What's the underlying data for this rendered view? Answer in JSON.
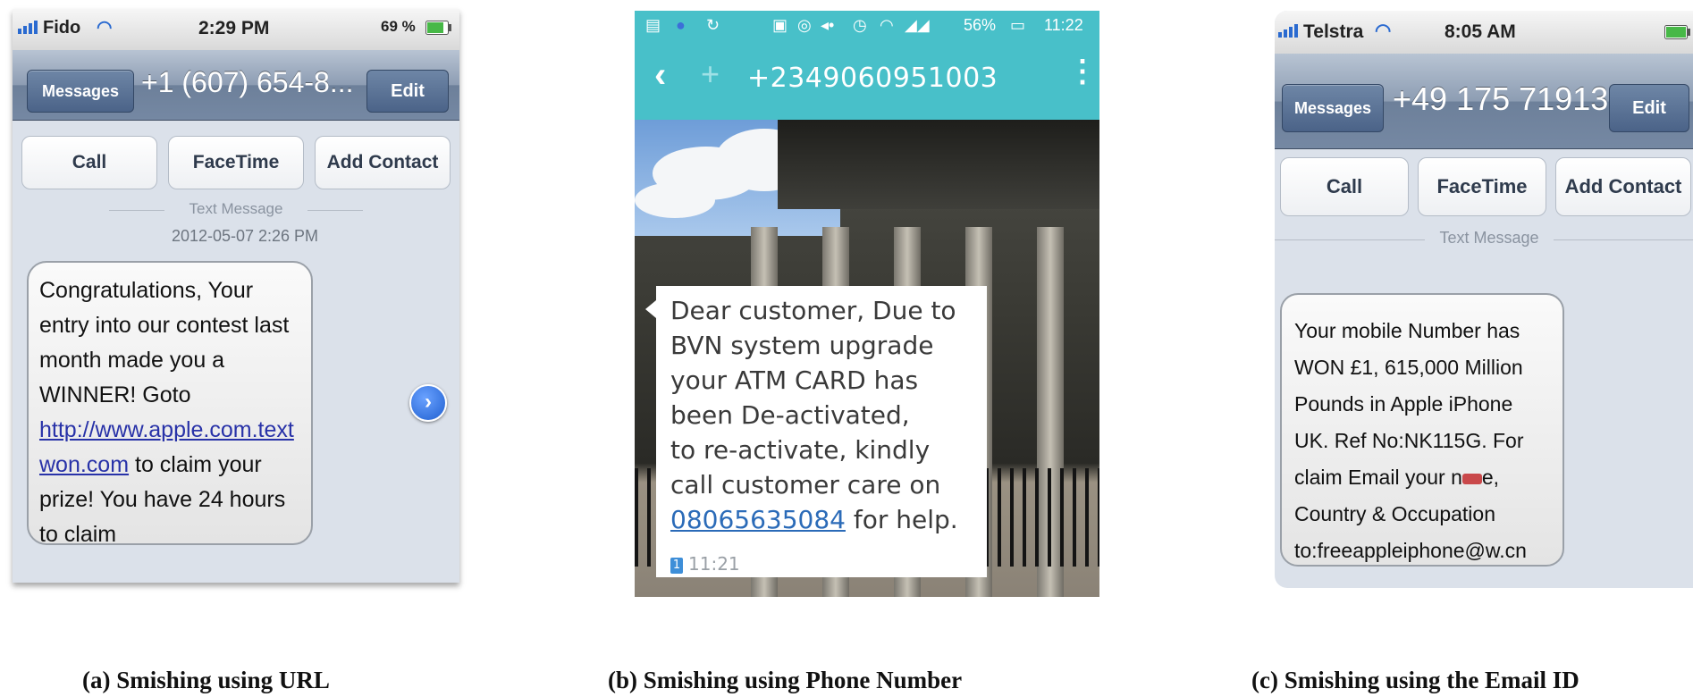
{
  "panel_a": {
    "status": {
      "carrier": "Fido",
      "time": "2:29 PM",
      "battery": "69 %"
    },
    "nav": {
      "back_label": "Messages",
      "title": "+1 (607) 654-8...",
      "edit_label": "Edit"
    },
    "actions": [
      "Call",
      "FaceTime",
      "Add Contact"
    ],
    "separator_label": "Text Message",
    "timestamp": "2012-05-07 2:26 PM",
    "message_lines": [
      "Congratulations, Your",
      "entry into our contest last",
      "month made you a",
      "WINNER! Goto"
    ],
    "link_line_1": "http://www.apple.com.text",
    "link_line_2": "won.com",
    "link_line_2_tail": " to claim your",
    "message_tail_lines": [
      "prize! You have 24 hours",
      "to claim"
    ],
    "detail_icon": "chevron-right-icon",
    "caption": "(a) Smishing using URL"
  },
  "panel_b": {
    "status": {
      "battery": "56%",
      "time": "11:22"
    },
    "title": "+2349060951003",
    "message_lines": [
      "Dear customer, Due to",
      "BVN system upgrade",
      "your ATM CARD has",
      "been De-activated,",
      "to re-activate, kindly",
      "call customer care on"
    ],
    "phone_number": "08065635084",
    "phone_tail": " for help.",
    "sim_label": "1",
    "message_time": "11:21",
    "caption": "(b) Smishing using Phone Number"
  },
  "panel_c": {
    "status": {
      "carrier": "Telstra",
      "time": "8:05 AM"
    },
    "nav": {
      "back_label": "Messages",
      "title": "+49 175 71913...",
      "edit_label": "Edit"
    },
    "actions": [
      "Call",
      "FaceTime",
      "Add Contact"
    ],
    "separator_label": "Text Message",
    "message_lines": [
      "Your mobile Number has",
      "WON £1, 615,000 Million",
      "Pounds in Apple iPhone",
      "UK. Ref No:NK115G. For"
    ],
    "line5_start": "claim Email your n",
    "line5_end": "e,",
    "message_tail_lines": [
      "Country & Occupation",
      "to:freeappleiphone@w.cn"
    ],
    "caption": "(c) Smishing using the Email  ID"
  }
}
